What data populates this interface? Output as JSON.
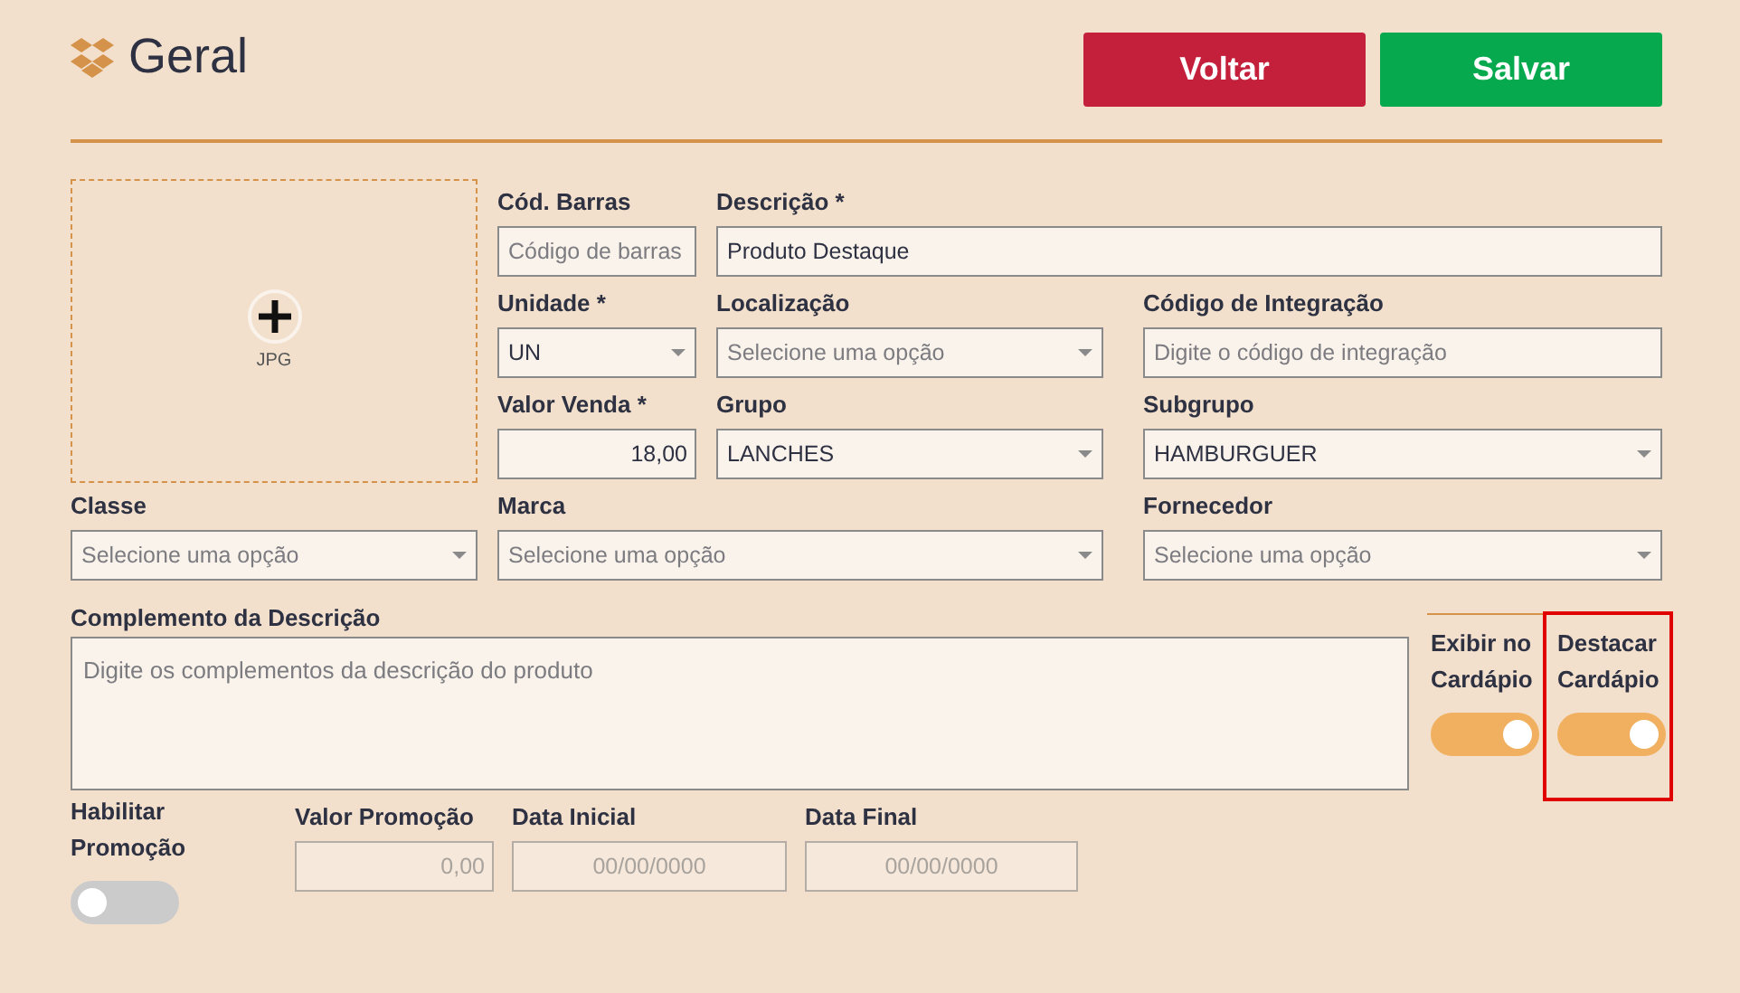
{
  "header": {
    "title": "Geral",
    "buttons": [
      {
        "label": "Voltar",
        "kind": "back"
      },
      {
        "label": "Salvar",
        "kind": "save"
      }
    ]
  },
  "image_upload": {
    "caption": "JPG"
  },
  "fields": [
    {
      "label": "Cód. Barras",
      "kind": "input",
      "placeholder": "Código de barras"
    },
    {
      "label": "Descrição *",
      "kind": "input",
      "value": "Produto Destaque"
    },
    {
      "label": "Unidade *",
      "kind": "select",
      "value": "UN"
    },
    {
      "label": "Localização",
      "kind": "select",
      "placeholder": "Selecione uma opção"
    },
    {
      "label": "Código de Integração",
      "kind": "input",
      "placeholder": "Digite o código de integração"
    },
    {
      "label": "Valor Venda *",
      "kind": "number",
      "value": "18,00"
    },
    {
      "label": "Grupo",
      "kind": "select",
      "value": "LANCHES"
    },
    {
      "label": "Subgrupo",
      "kind": "select",
      "value": "HAMBURGUER"
    },
    {
      "label": "Classe",
      "kind": "select",
      "placeholder": "Selecione uma opção"
    },
    {
      "label": "Marca",
      "kind": "select",
      "placeholder": "Selecione uma opção"
    },
    {
      "label": "Fornecedor",
      "kind": "select",
      "placeholder": "Selecione uma opção"
    }
  ],
  "complement": {
    "label": "Complemento da Descrição",
    "placeholder": "Digite os complementos da descrição do produto"
  },
  "toggles": [
    {
      "label": "Exibir no Cardápio",
      "on": true,
      "highlighted": false
    },
    {
      "label": "Destacar Cardápio",
      "on": true,
      "highlighted": true
    }
  ],
  "promotion": {
    "label": "Habilitar Promoção",
    "on": false,
    "fields": [
      {
        "label": "Valor Promoção",
        "kind": "number",
        "placeholder": "0,00",
        "disabled": true
      },
      {
        "label": "Data Inicial",
        "kind": "date",
        "placeholder": "00/00/0000",
        "disabled": true
      },
      {
        "label": "Data Final",
        "kind": "date",
        "placeholder": "00/00/0000",
        "disabled": true
      }
    ]
  }
}
